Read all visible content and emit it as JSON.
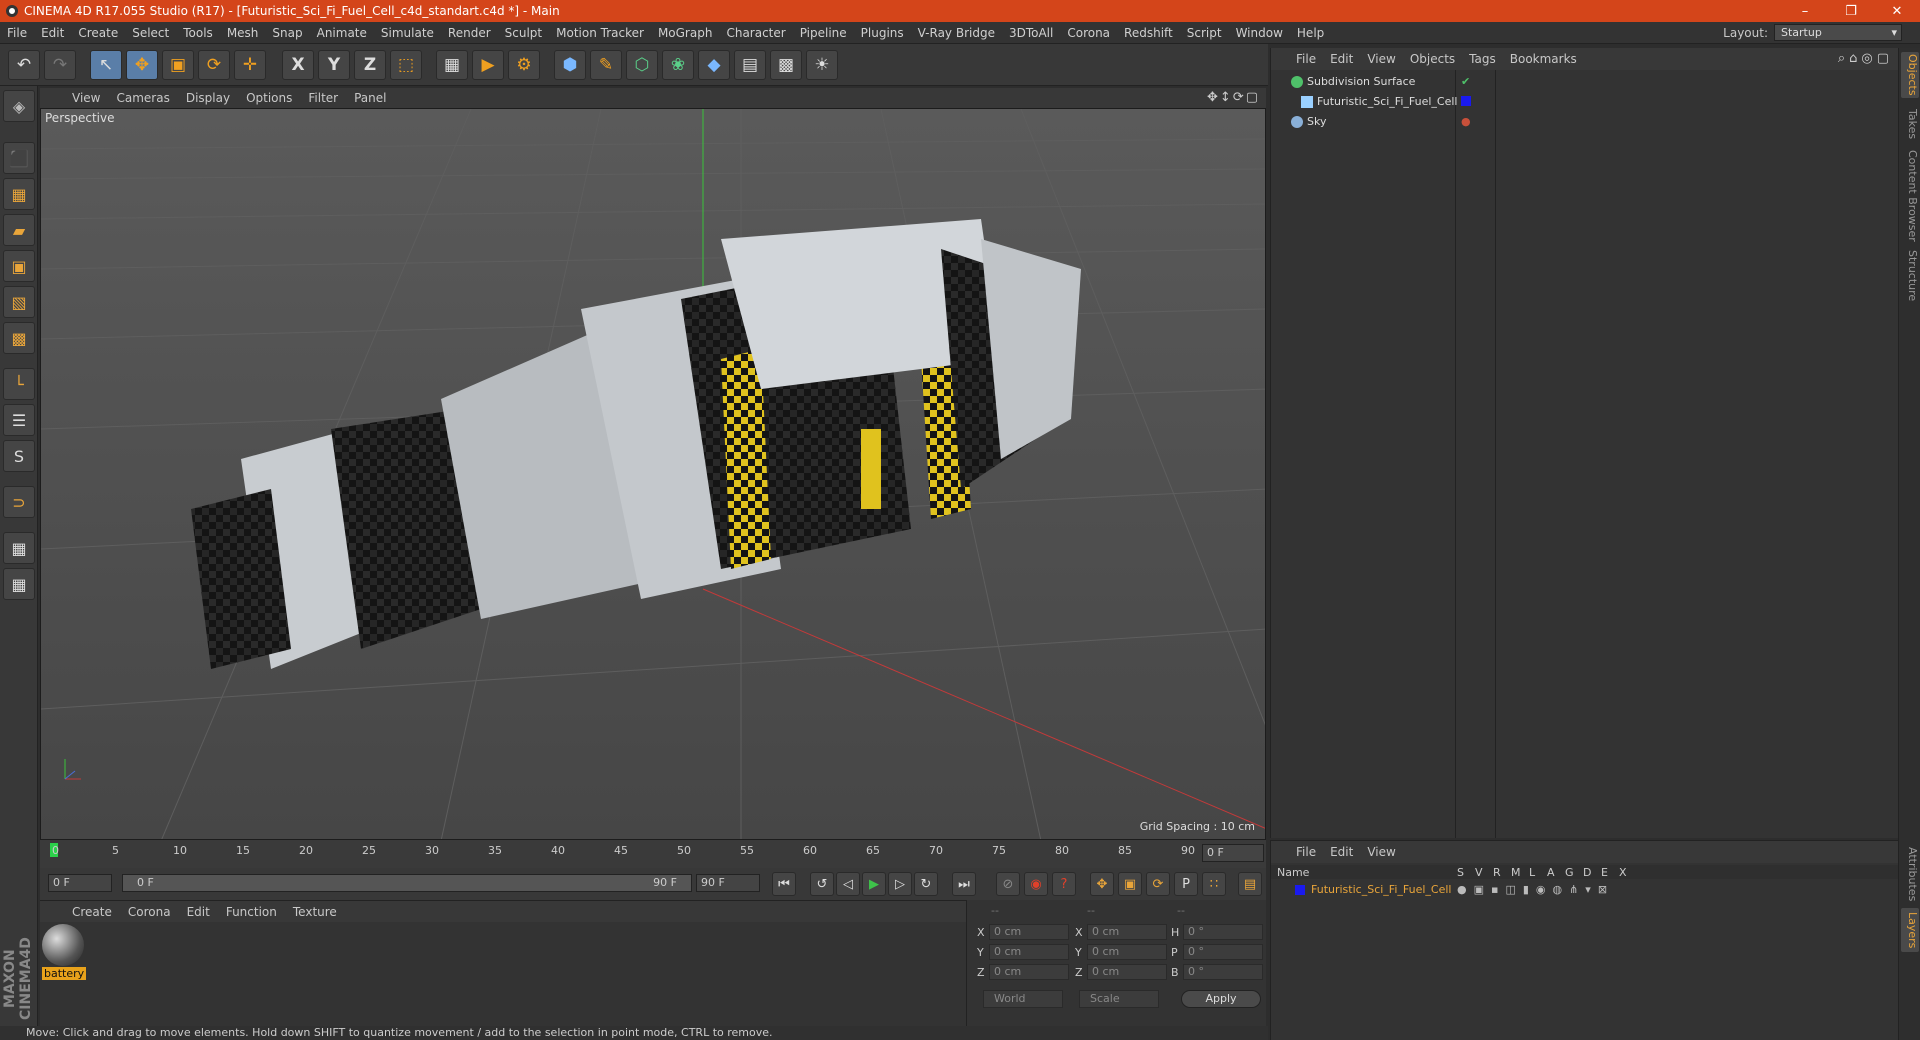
{
  "window": {
    "title": "CINEMA 4D R17.055 Studio (R17) - [Futuristic_Sci_Fi_Fuel_Cell_c4d_standart.c4d *] - Main",
    "minimize": "–",
    "maximize": "❐",
    "close": "✕"
  },
  "menubar": {
    "items": [
      "File",
      "Edit",
      "Create",
      "Select",
      "Tools",
      "Mesh",
      "Snap",
      "Animate",
      "Simulate",
      "Render",
      "Sculpt",
      "Motion Tracker",
      "MoGraph",
      "Character",
      "Pipeline",
      "Plugins",
      "V-Ray Bridge",
      "3DToAll",
      "Corona",
      "Redshift",
      "Script",
      "Window",
      "Help"
    ],
    "layout_label": "Layout:",
    "layout_value": "Startup"
  },
  "toolbar": {
    "undo": "↶",
    "redo": "↷",
    "select": "↖",
    "move": "✥",
    "scale": "▣",
    "rotate": "⟳",
    "recent": "✛",
    "x_axis": "X",
    "y_axis": "Y",
    "z_axis": "Z",
    "coord": "⬚",
    "render_region": "▦",
    "render_view": "▶",
    "render_settings": "⚙",
    "cube": "⬢",
    "pen": "✎",
    "subdiv": "⬡",
    "mograph": "❀",
    "deformer": "◆",
    "floor": "▤",
    "camera": "▩",
    "light": "☀"
  },
  "lefttools": [
    "◈",
    "⬛",
    "▦",
    "▰",
    "▣",
    "▧",
    "▩",
    "└",
    "☰",
    "S",
    "⊃",
    "▦",
    "▦"
  ],
  "brand": "MAXON CINEMA4D",
  "viewport": {
    "menu": [
      "View",
      "Cameras",
      "Display",
      "Options",
      "Filter",
      "Panel"
    ],
    "nav": "✥↕⟳▢",
    "label": "Perspective",
    "grid_spacing": "Grid Spacing : 10 cm"
  },
  "timeline": {
    "ticks": [
      "0",
      "5",
      "10",
      "15",
      "20",
      "25",
      "30",
      "35",
      "40",
      "45",
      "50",
      "55",
      "60",
      "65",
      "70",
      "75",
      "80",
      "85",
      "90"
    ],
    "current_frame": "0 F"
  },
  "transport": {
    "start_field": "0 F",
    "range_start": "0 F",
    "range_end": "90 F",
    "end_field": "90 F",
    "buttons": [
      "⏮",
      "↺",
      "◁",
      "▶",
      "▷",
      "↻",
      "⏭"
    ],
    "record": [
      "⊘",
      "◉",
      "?",
      "✥",
      "▣",
      "⟳",
      "P",
      "∷",
      "▤"
    ]
  },
  "materials": {
    "menu": [
      "Create",
      "Corona",
      "Edit",
      "Function",
      "Texture"
    ],
    "items": [
      {
        "name": "battery"
      }
    ]
  },
  "coordinates": {
    "header": [
      "--",
      "--",
      "--"
    ],
    "rows": [
      {
        "a": "X",
        "av": "0 cm",
        "b": "X",
        "bv": "0 cm",
        "c": "H",
        "cv": "0 °"
      },
      {
        "a": "Y",
        "av": "0 cm",
        "b": "Y",
        "bv": "0 cm",
        "c": "P",
        "cv": "0 °"
      },
      {
        "a": "Z",
        "av": "0 cm",
        "b": "Z",
        "bv": "0 cm",
        "c": "B",
        "cv": "0 °"
      }
    ],
    "space": "World",
    "mode": "Scale",
    "apply": "Apply"
  },
  "status": "Move: Click and drag to move elements. Hold down SHIFT to quantize movement / add to the selection in point mode, CTRL to remove.",
  "objects": {
    "menu": [
      "File",
      "Edit",
      "View",
      "Objects",
      "Tags",
      "Bookmarks"
    ],
    "icons": "⌕⌂◎▢",
    "rows": [
      {
        "name": "Subdivision Surface",
        "color": "#4fc16a"
      },
      {
        "name": "Futuristic_Sci_Fi_Fuel_Cell",
        "color": "#9ad0ff"
      },
      {
        "name": "Sky",
        "color": "#8ab0d8"
      }
    ]
  },
  "layers": {
    "menu": [
      "File",
      "Edit",
      "View"
    ],
    "header_name": "Name",
    "header_cols": [
      "S",
      "V",
      "R",
      "M",
      "L",
      "A",
      "G",
      "D",
      "E",
      "X"
    ],
    "rows": [
      {
        "name": "Futuristic_Sci_Fi_Fuel_Cell",
        "color": "#1a1aee"
      }
    ]
  },
  "right_tabs": [
    "Objects",
    "Takes",
    "Content Browser",
    "Structure",
    "Attributes",
    "Layers"
  ]
}
